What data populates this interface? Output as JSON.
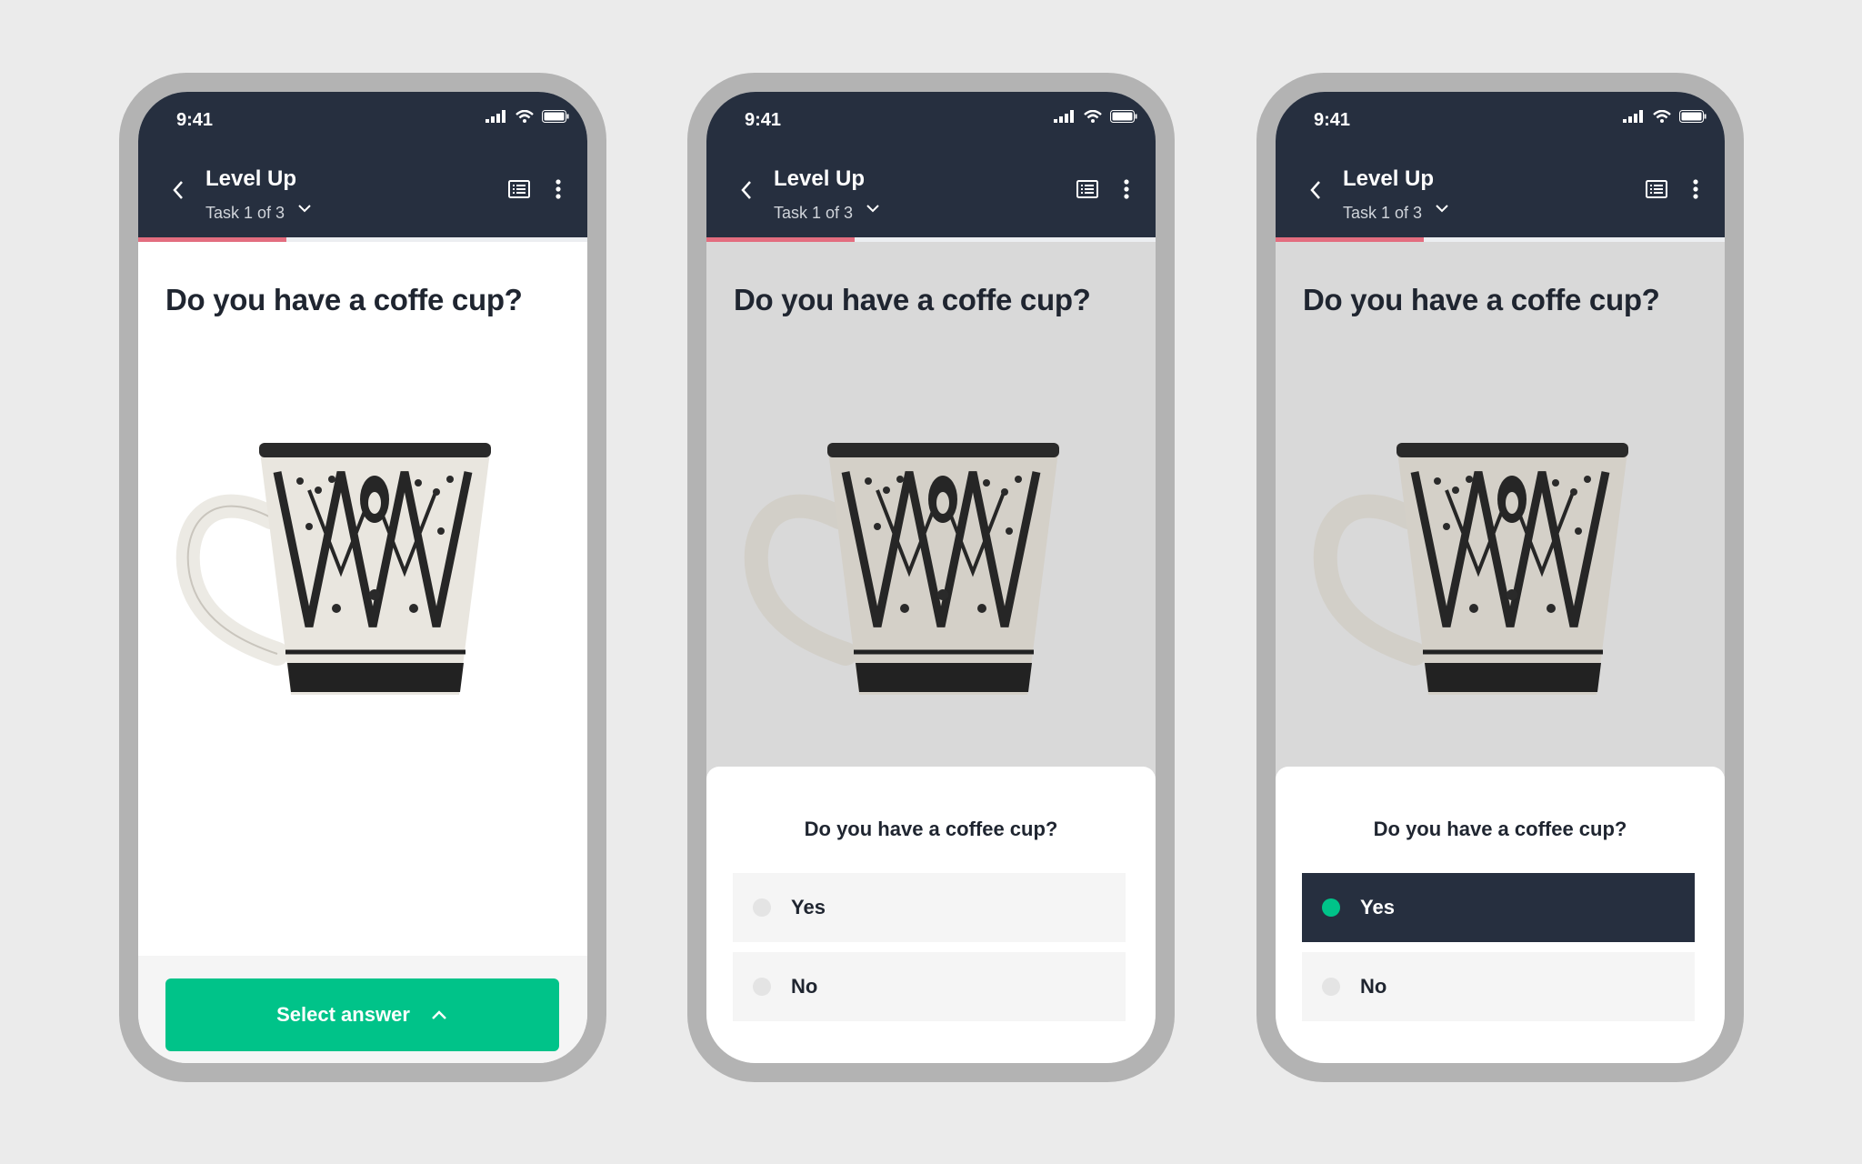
{
  "status_bar": {
    "time": "9:41"
  },
  "header": {
    "title": "Level Up",
    "subtitle": "Task 1 of 3"
  },
  "progress": {
    "fraction": 0.33
  },
  "question": {
    "text": "Do you have a coffe cup?"
  },
  "footer": {
    "select_label": "Select answer"
  },
  "answer_sheet": {
    "question": "Do you have a coffee cup?",
    "options": [
      "Yes",
      "No"
    ]
  },
  "selection_state": {
    "screen_2": "none",
    "screen_3": "Yes"
  },
  "colors": {
    "background": "#ebebeb",
    "frame": "#b3b3b3",
    "appbar": "#262f3f",
    "accent_green": "#00c389",
    "progress_pink": "#e36d7f",
    "selected_option": "#262f3f"
  },
  "icons": [
    "back-chevron-icon",
    "list-icon",
    "more-vertical-icon",
    "chevron-down-icon",
    "chevron-up-icon",
    "signal-icon",
    "wifi-icon",
    "battery-icon"
  ]
}
